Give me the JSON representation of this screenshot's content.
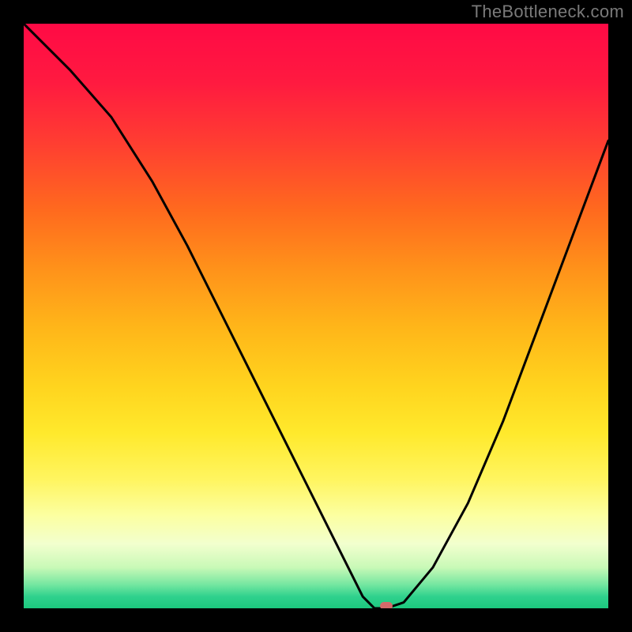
{
  "watermark": "TheBottleneck.com",
  "chart_data": {
    "type": "line",
    "title": "",
    "xlabel": "",
    "ylabel": "",
    "x_range": [
      0,
      100
    ],
    "y_range": [
      0,
      100
    ],
    "series": [
      {
        "name": "bottleneck-curve",
        "x": [
          0,
          8,
          15,
          22,
          28,
          34,
          40,
          46,
          52,
          56,
          58,
          60,
          62,
          65,
          70,
          76,
          82,
          88,
          94,
          100
        ],
        "values": [
          100,
          92,
          84,
          73,
          62,
          50,
          38,
          26,
          14,
          6,
          2,
          0,
          0,
          1,
          7,
          18,
          32,
          48,
          64,
          80
        ]
      }
    ],
    "marker": {
      "x": 62,
      "y": 0,
      "name": "optimal-point"
    },
    "background_gradient": {
      "orientation": "vertical-top-to-bottom",
      "stops": [
        {
          "pos": 0,
          "color": "#ff0a45"
        },
        {
          "pos": 32,
          "color": "#ff6a1e"
        },
        {
          "pos": 62,
          "color": "#ffd41e"
        },
        {
          "pos": 84,
          "color": "#fcffa0"
        },
        {
          "pos": 100,
          "color": "#1cc87e"
        }
      ]
    }
  }
}
